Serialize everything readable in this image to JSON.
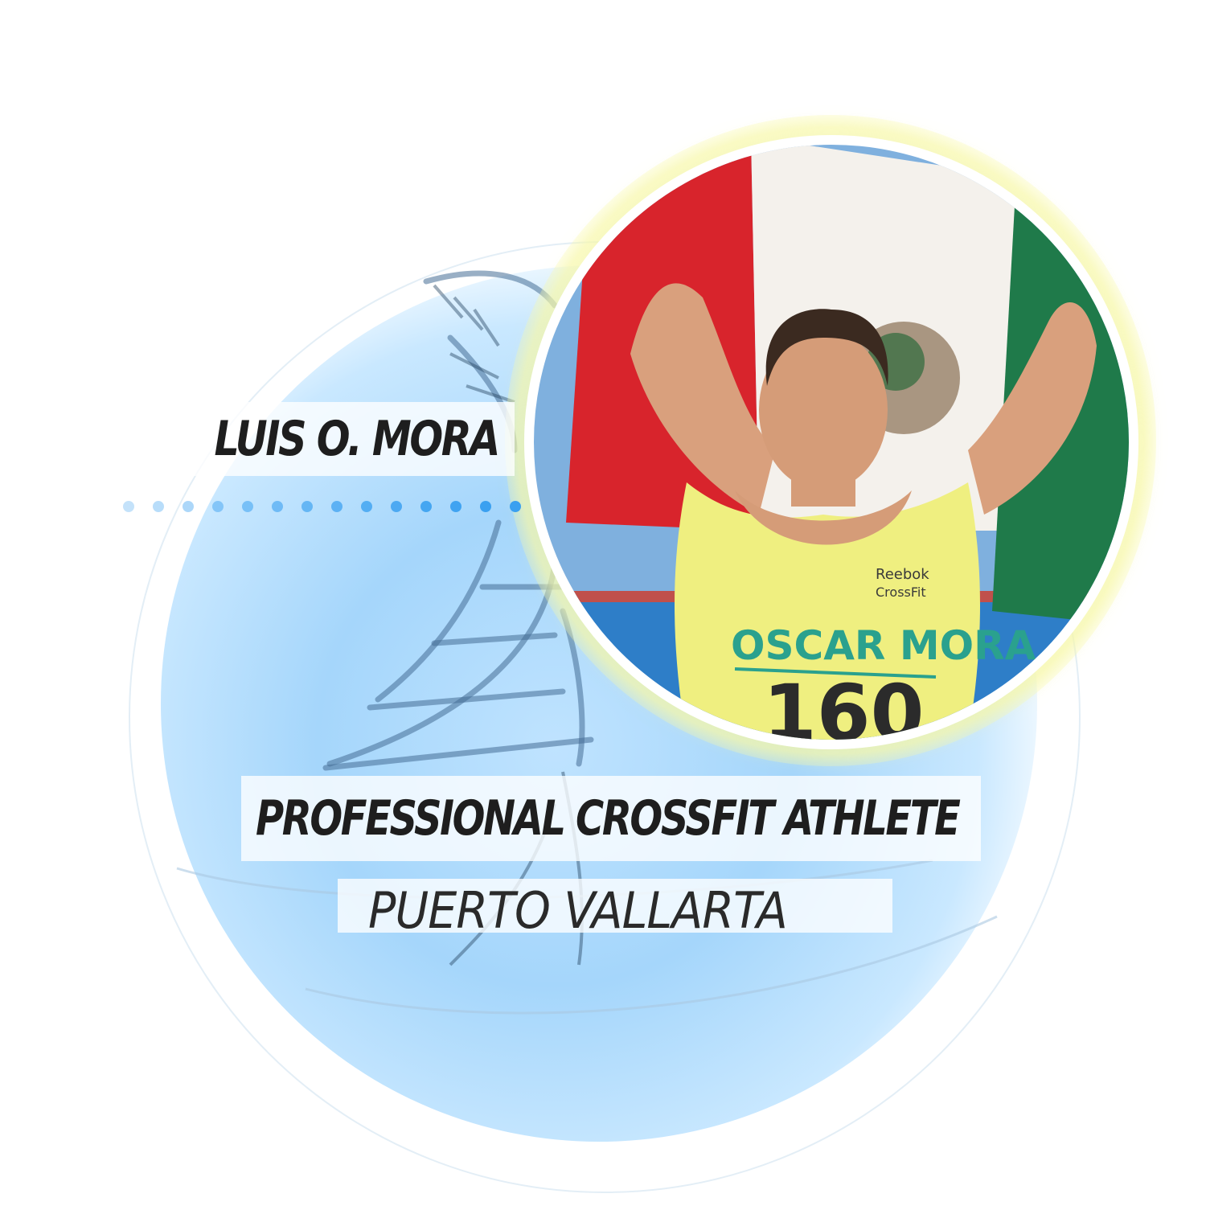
{
  "profile": {
    "name": "LUIS O. MORA",
    "role": "PROFESSIONAL CROSSFIT ATHLETE",
    "location": "PUERTO VALLARTA"
  },
  "photo": {
    "subject": "athlete-holding-mexican-flag",
    "shirt_text": "OSCAR MORA",
    "shirt_number": "160",
    "shirt_brand": "Reebok",
    "shirt_brand_sub": "CrossFit"
  },
  "colors": {
    "accent_blue": "#3aa0f0",
    "orb_blue": "#a5d6fb",
    "glow_yellow": "#f4f6aa",
    "text_dark": "#1e1e1e",
    "flag_red": "#d8242c",
    "flag_white": "#f4f1ec",
    "flag_green": "#1f7a4a",
    "shirt_yellow": "#efef80",
    "shirt_teal": "#2aa18e"
  }
}
